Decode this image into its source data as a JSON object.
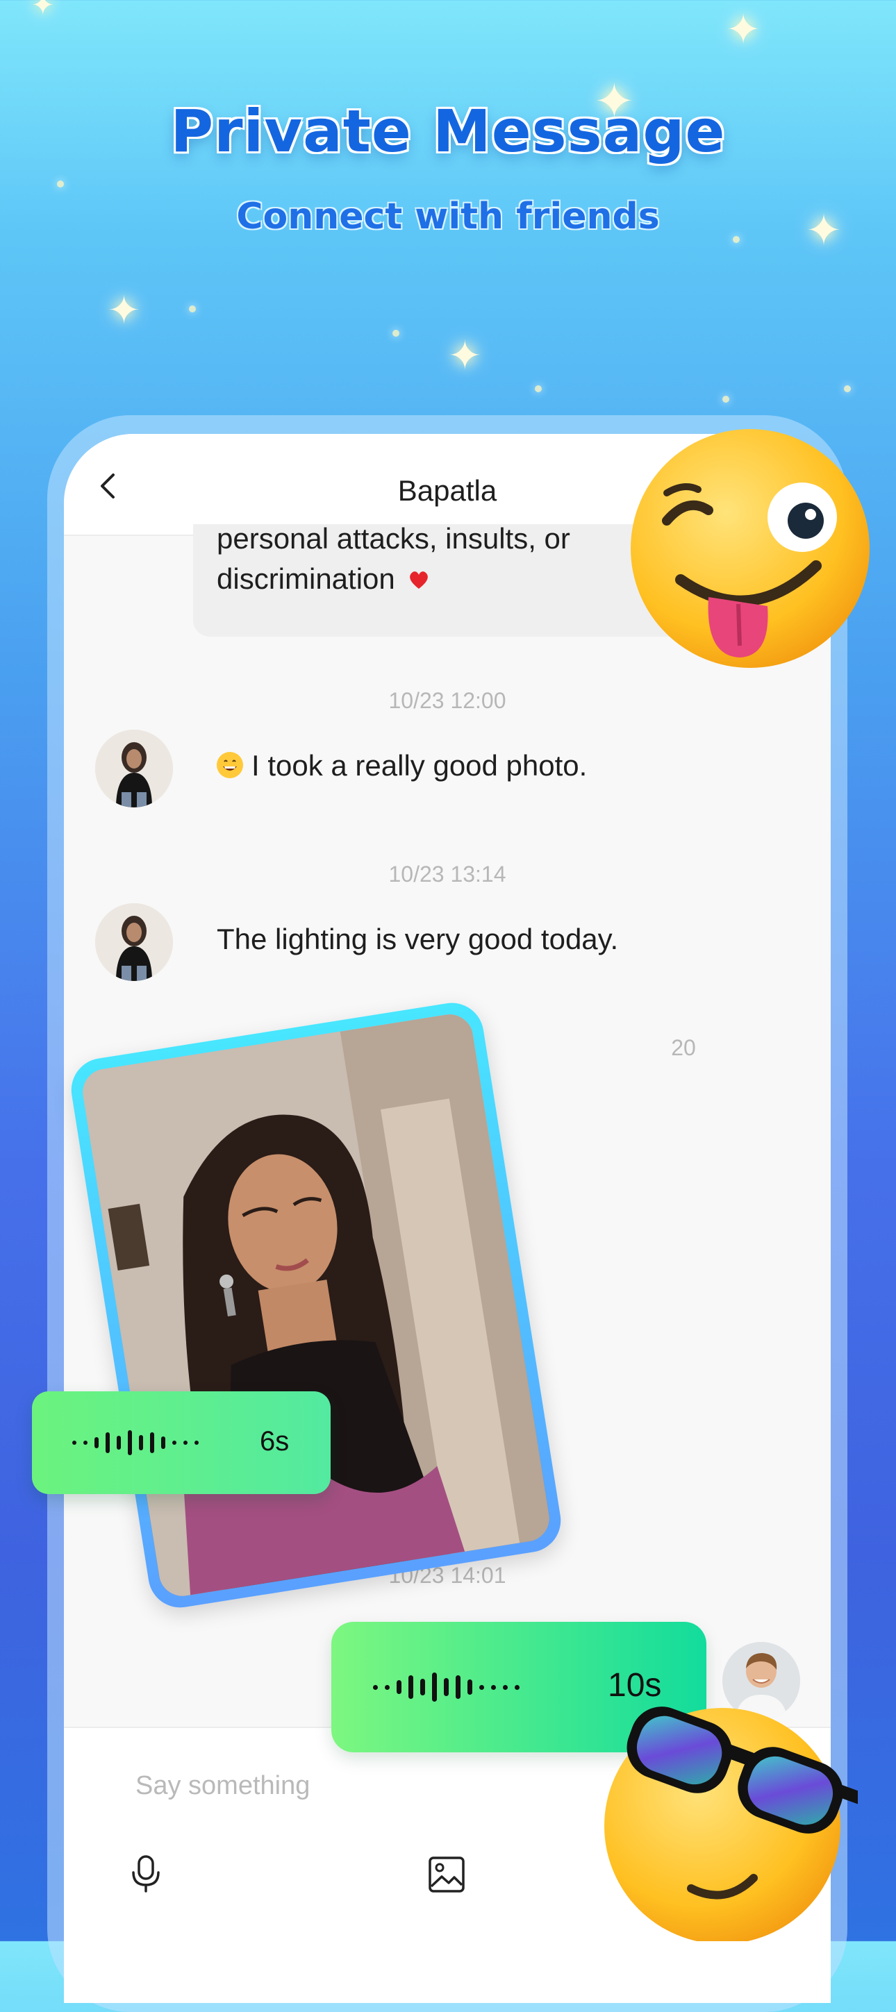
{
  "header": {
    "headline": "Private Message",
    "subheadline": "Connect with friends"
  },
  "chat": {
    "title": "Bapatla",
    "partial_message": {
      "line1": "personal attacks, insults, or",
      "line2": "discrimination"
    },
    "messages": [
      {
        "timestamp": "10/23 12:00",
        "text": "I took a really good photo."
      },
      {
        "timestamp": "10/23 13:14",
        "text": "The lighting is very good today."
      },
      {
        "timestamp": "20"
      },
      {
        "timestamp": "10/23 14:01"
      }
    ],
    "voice_left_duration": "6s",
    "voice_right_duration": "10s",
    "input_placeholder": "Say something"
  },
  "icons": {
    "back": "back-arrow-icon",
    "mic": "microphone-icon",
    "image": "image-icon",
    "heart": "heart-emoji",
    "grin": "grinning-emoji",
    "wink": "wink-tongue-emoji",
    "cool": "sunglasses-emoji"
  },
  "colors": {
    "voice_bubble_start": "#7df780",
    "voice_bubble_end": "#12dc9c",
    "headline": "#1466e0"
  }
}
